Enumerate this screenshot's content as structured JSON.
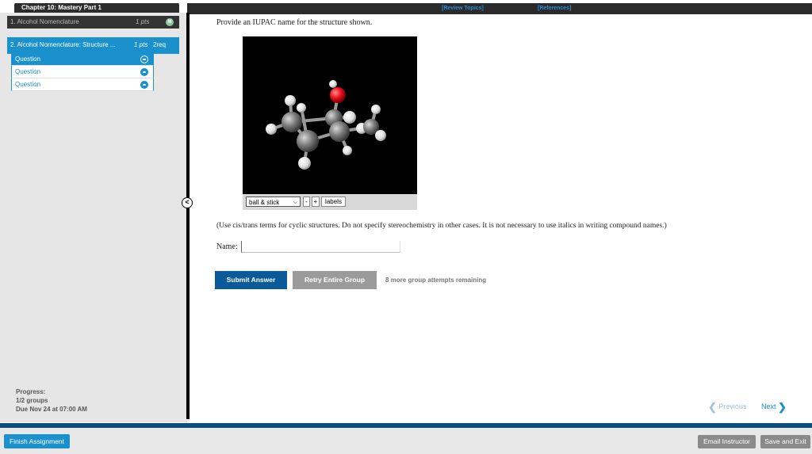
{
  "header": {
    "chapter_title": "Chapter 10: Mastery Part 1",
    "review_topics": "[Review Topics]",
    "references": "[References]"
  },
  "sidebar": {
    "item1": {
      "label": "1. Alcohol Nomenclature",
      "points": "1 pts",
      "badge": "M"
    },
    "item2": {
      "label": "2. Alcohol Nomenclature: Structure ...",
      "points": "1 pts",
      "req": "2req"
    },
    "questions": [
      "Question",
      "Question",
      "Question"
    ],
    "collapse_glyph": "<",
    "progress_label": "Progress:",
    "progress_value": "1/2 groups",
    "due": "Due Nov 24 at 07:00 AM"
  },
  "main": {
    "prompt": "Provide an IUPAC name for the structure shown.",
    "viewer": {
      "mode": "ball & stick",
      "zoom_out": "-",
      "zoom_in": "+",
      "labels": "labels"
    },
    "note": "(Use cis/trans terms for cyclic structures. Do not specify stereochemistry in other cases. It is not necessary to use italics in writing compound names.)",
    "name_label": "Name:",
    "name_value": "",
    "submit": "Submit Answer",
    "retry": "Retry Entire Group",
    "attempts": "8 more group attempts remaining",
    "previous": "Previous",
    "next": "Next"
  },
  "footer": {
    "finish": "Finish Assignment",
    "email": "Email Instructor",
    "save_exit": "Save and Exit"
  },
  "colors": {
    "accent": "#1a90cc",
    "submit": "#0a5a99",
    "footer_line": "#0c4f7c",
    "oxygen": "#e8101a",
    "carbon": "#8a8a8a",
    "hydrogen": "#f0f0f0"
  }
}
